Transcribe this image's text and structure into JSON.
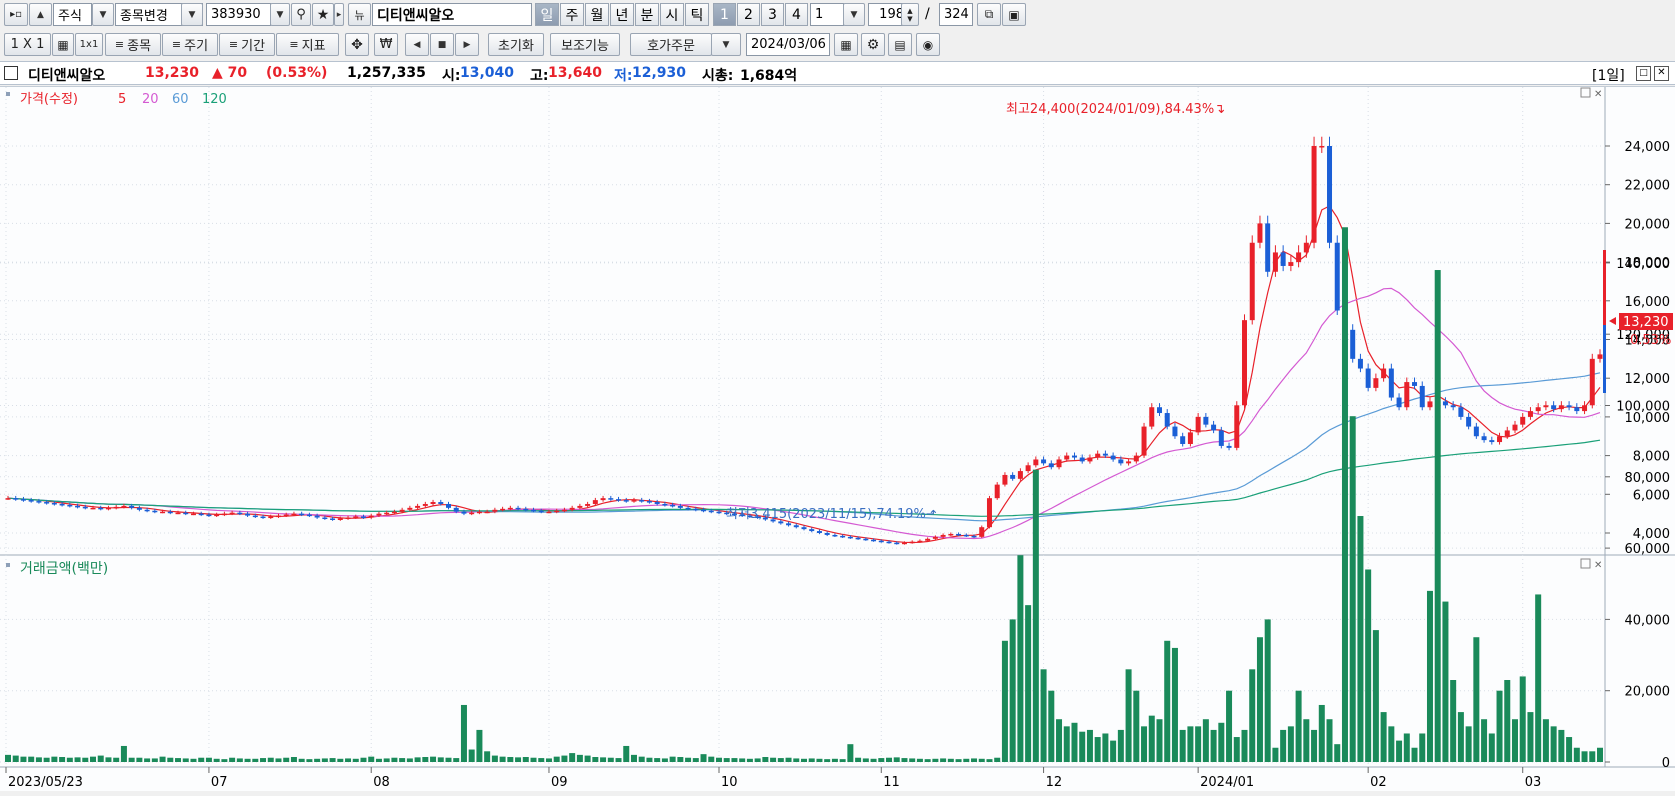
{
  "toolbar1": {
    "market": "주식",
    "change_item": "종목변경",
    "code": "383930",
    "new_badge": "뉴",
    "name": "디티앤씨알오",
    "periods": [
      "일",
      "주",
      "월",
      "년",
      "분",
      "시",
      "틱"
    ],
    "selected_period": "일",
    "numbers": [
      "1",
      "2",
      "3",
      "4"
    ],
    "selected_number": "1",
    "unit_value": "1",
    "count": "198",
    "slash": "/",
    "total": "324"
  },
  "toolbar2": {
    "layout": "1 X 1",
    "item_btn": "종목",
    "cycle_btn": "주기",
    "range_btn": "기간",
    "index_btn": "지표",
    "won": "₩",
    "reset": "초기화",
    "aux": "보조기능",
    "order": "호가주문",
    "date": "2024/03/06"
  },
  "info": {
    "name": "디티앤씨알오",
    "price": "13,230",
    "change": "▲ 70",
    "rate": "(0.53%)",
    "volume": "1,257,335",
    "open_label": "시:",
    "open": "13,040",
    "high_label": "고:",
    "high": "13,640",
    "low_label": "저:",
    "low": "12,930",
    "cap_label": "시총:",
    "cap": "1,684억",
    "period_tag": "[1일]"
  },
  "price_pane": {
    "legend": [
      "가격(수정)",
      "5",
      "20",
      "60",
      "120"
    ],
    "high_note": "최고24,400(2024/01/09),84.43%",
    "low_note": "최저3,415(2023/11/15),74.19%",
    "current_tag": "13,230",
    "rate_tag": "0.53%",
    "y_ticks": [
      "4,000",
      "6,000",
      "8,000",
      "10,000",
      "12,000",
      "14,000",
      "16,000",
      "18,000",
      "20,000",
      "22,000",
      "24,000"
    ]
  },
  "volume_pane": {
    "legend": "거래금액(백만)",
    "y_ticks": [
      "0",
      "20,000",
      "40,000",
      "60,000",
      "80,000",
      "100,000",
      "120,000",
      "140,000"
    ]
  },
  "x_ticks": [
    "2023/05/23",
    "07",
    "08",
    "09",
    "10",
    "11",
    "12",
    "2024/01",
    "02",
    "03"
  ],
  "colors": {
    "up": "#e8212a",
    "down": "#1b5fd6",
    "ma5": "#e8212a",
    "ma20": "#d45ad2",
    "ma60": "#5a9bd6",
    "ma120": "#1aa078",
    "volume": "#1a8a5a"
  },
  "chart_data": {
    "type": "candlestick",
    "period": "daily",
    "first_date": "2023/05/23",
    "last_date": "2024/03/06",
    "price": {
      "last": 13230,
      "open": 13040,
      "high": 13640,
      "low": 12930
    },
    "extremes": {
      "max": 24400,
      "max_date": "2024/01/09",
      "min": 3415,
      "min_date": "2023/11/15"
    },
    "ylim": [
      3000,
      25500
    ],
    "moving_averages": [
      5,
      20,
      60,
      120
    ],
    "volume_ylim": [
      0,
      150000
    ],
    "closes": [
      5800,
      5750,
      5700,
      5650,
      5600,
      5550,
      5500,
      5450,
      5400,
      5350,
      5300,
      5300,
      5250,
      5300,
      5350,
      5400,
      5300,
      5200,
      5150,
      5100,
      5100,
      5050,
      5050,
      5000,
      5000,
      4950,
      4900,
      4950,
      5000,
      5050,
      5000,
      4900,
      4850,
      4800,
      4850,
      4900,
      4950,
      5000,
      4950,
      4900,
      4800,
      4750,
      4700,
      4750,
      4800,
      4850,
      4800,
      4900,
      5000,
      5050,
      5100,
      5200,
      5300,
      5400,
      5500,
      5600,
      5500,
      5300,
      5100,
      5000,
      5050,
      5100,
      5100,
      5200,
      5250,
      5300,
      5250,
      5200,
      5150,
      5100,
      5100,
      5150,
      5200,
      5300,
      5400,
      5500,
      5700,
      5800,
      5750,
      5700,
      5650,
      5700,
      5650,
      5600,
      5500,
      5450,
      5400,
      5300,
      5250,
      5200,
      5150,
      5100,
      5050,
      5000,
      4950,
      4900,
      4850,
      4800,
      4700,
      4600,
      4500,
      4400,
      4300,
      4200,
      4100,
      4000,
      3900,
      3850,
      3800,
      3750,
      3700,
      3650,
      3600,
      3550,
      3500,
      3450,
      3500,
      3550,
      3600,
      3700,
      3800,
      3900,
      3950,
      3900,
      3850,
      3800,
      4300,
      5800,
      6500,
      7000,
      6800,
      7200,
      7500,
      7800,
      7600,
      7400,
      7800,
      8000,
      7900,
      7700,
      7900,
      8100,
      8000,
      7800,
      7600,
      7700,
      8000,
      9500,
      10500,
      10200,
      9500,
      9000,
      8600,
      9200,
      10000,
      9600,
      9300,
      8500,
      8400,
      10600,
      15000,
      19000,
      20000,
      17500,
      18500,
      17800,
      18000,
      18500,
      19000,
      24000,
      24000,
      19000,
      15500,
      14500,
      13000,
      12500,
      11500,
      12000,
      12500,
      11000,
      10500,
      11800,
      11600,
      10500,
      10800,
      10800,
      10600,
      10500,
      10000,
      9500,
      9000,
      8800,
      8700,
      9000,
      9300,
      9600,
      10000,
      10300,
      10500,
      10600,
      10400,
      10600,
      10500,
      10300,
      10600,
      13000,
      13230
    ],
    "volumes": [
      2000,
      1800,
      1500,
      1500,
      1300,
      1200,
      1500,
      1400,
      1200,
      1300,
      1200,
      1500,
      1800,
      1300,
      1200,
      4500,
      1200,
      1200,
      1000,
      1000,
      1500,
      1200,
      1100,
      1000,
      900,
      1200,
      1200,
      900,
      800,
      1200,
      1000,
      900,
      900,
      1100,
      1200,
      1000,
      1200,
      1400,
      900,
      800,
      900,
      1000,
      1100,
      900,
      1000,
      900,
      1200,
      1500,
      900,
      1000,
      1200,
      1100,
      1000,
      1300,
      1400,
      1500,
      1300,
      1200,
      1100,
      16000,
      3500,
      9000,
      3000,
      1800,
      1500,
      1400,
      1300,
      1400,
      1200,
      1100,
      1000,
      1500,
      1800,
      2500,
      2000,
      1800,
      1400,
      1300,
      1200,
      1100,
      4500,
      2000,
      1500,
      1200,
      1100,
      1000,
      1500,
      1400,
      1200,
      1100,
      2200,
      1500,
      1200,
      1100,
      1100,
      1000,
      900,
      1000,
      1400,
      1200,
      1100,
      1200,
      1000,
      900,
      1000,
      900,
      800,
      900,
      800,
      5000,
      1200,
      1000,
      900,
      1100,
      1200,
      1300,
      1100,
      1000,
      900,
      800,
      900,
      1000,
      900,
      800,
      900,
      1000,
      900,
      800,
      1200,
      34000,
      40000,
      58000,
      44000,
      82000,
      26000,
      20000,
      12000,
      10000,
      11000,
      8500,
      9000,
      7000,
      8000,
      6000,
      9000,
      26000,
      20000,
      10000,
      13000,
      12000,
      34000,
      32000,
      9000,
      10000,
      10000,
      12000,
      9000,
      11000,
      20000,
      7000,
      9000,
      26000,
      35000,
      40000,
      4000,
      9000,
      10000,
      20000,
      12000,
      9000,
      16000,
      12000,
      5000,
      150000,
      97000,
      69000,
      54000,
      37000,
      14000,
      10000,
      6000,
      8000,
      4000,
      8000,
      48000,
      138000,
      45000,
      23000,
      14000,
      10000,
      35000,
      12000,
      8000,
      20000,
      23000,
      12000,
      24000,
      14000,
      47000,
      12000,
      10000,
      9000,
      7000,
      4000,
      3000,
      3000,
      4000,
      5000,
      4000,
      3000,
      2500,
      3000,
      5000,
      4000,
      3000,
      4000,
      3500,
      4000,
      4500,
      3000,
      3000,
      11000,
      7000,
      5000,
      3000,
      4000,
      3000,
      3000,
      9000,
      2500,
      4000,
      16000,
      7000,
      8000,
      37000,
      51000,
      17000
    ]
  }
}
